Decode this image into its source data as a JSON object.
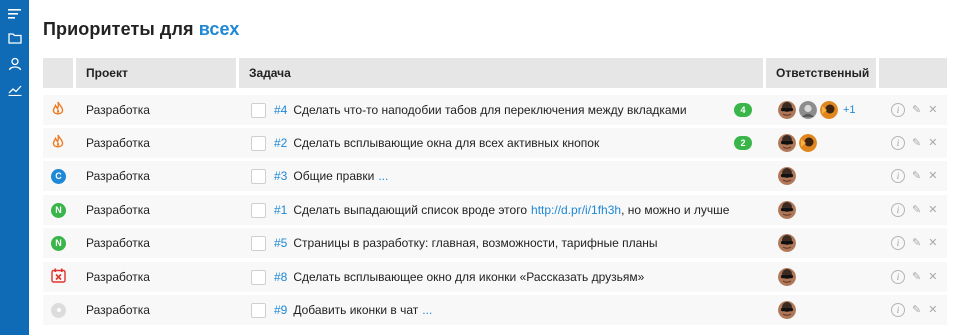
{
  "page": {
    "title_prefix": "Приоритеты для",
    "title_accent": "всех"
  },
  "sidebar": {
    "items": [
      {
        "icon": "menu-lines-icon"
      },
      {
        "icon": "folder-icon"
      },
      {
        "icon": "user-icon"
      },
      {
        "icon": "chart-line-icon"
      }
    ]
  },
  "table": {
    "headers": {
      "project": "Проект",
      "task": "Задача",
      "responsible": "Ответственный"
    },
    "rows": [
      {
        "status_icon": "fire-icon",
        "status_color": "#f07a22",
        "project": "Разработка",
        "num": "#4",
        "text": "Сделать что-то наподобии табов для переключения между вкладками",
        "comments": "4",
        "avatars": [
          "sunglasses",
          "gray",
          "orange"
        ],
        "extra": "+1"
      },
      {
        "status_icon": "fire-icon",
        "status_color": "#f07a22",
        "project": "Разработка",
        "num": "#2",
        "text": "Сделать всплывающие окна для всех активных кнопок",
        "comments": "2",
        "avatars": [
          "sunglasses",
          "orange"
        ]
      },
      {
        "status_icon": "letter-c-icon",
        "status_letter": "C",
        "status_color": "#1e88d6",
        "project": "Разработка",
        "num": "#3",
        "text": "Общие правки",
        "ellipsis": "...",
        "avatars": [
          "sunglasses"
        ]
      },
      {
        "status_icon": "letter-n-icon",
        "status_letter": "N",
        "status_color": "#3ab54a",
        "project": "Разработка",
        "num": "#1",
        "text_before": "Сделать выпадающий список вроде этого",
        "link": "http://d.pr/i/1fh3h",
        "text_after": ", но можно и лучше",
        "avatars": [
          "sunglasses"
        ]
      },
      {
        "status_icon": "letter-n-icon",
        "status_letter": "N",
        "status_color": "#3ab54a",
        "project": "Разработка",
        "num": "#5",
        "text": "Страницы в разработку: главная, возможности, тарифные планы",
        "avatars": [
          "sunglasses"
        ]
      },
      {
        "status_icon": "calendar-x-icon",
        "status_color": "#e0322d",
        "project": "Разработка",
        "num": "#8",
        "text": "Сделать всплывающее окно для иконки «Рассказать друзьям»",
        "avatars": [
          "sunglasses"
        ]
      },
      {
        "status_icon": "circle-dot-icon",
        "status_color": "#dcdcdc",
        "project": "Разработка",
        "num": "#9",
        "text": "Добавить иконки в чат",
        "ellipsis": "...",
        "avatars": [
          "sunglasses"
        ]
      }
    ]
  },
  "colors": {
    "sidebar": "#0f6bb5",
    "accent": "#1e88d6",
    "badge": "#3ab54a"
  }
}
